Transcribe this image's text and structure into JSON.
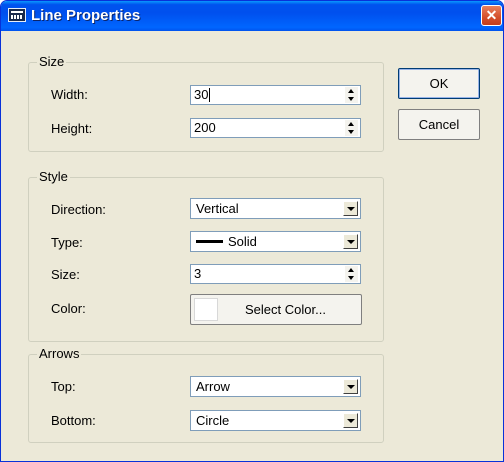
{
  "window": {
    "title": "Line Properties",
    "close_glyph": "✕"
  },
  "size_group": {
    "label": "Size",
    "width": {
      "label": "Width:",
      "value": "30"
    },
    "height": {
      "label": "Height:",
      "value": "200"
    }
  },
  "style_group": {
    "label": "Style",
    "direction": {
      "label": "Direction:",
      "value": "Vertical"
    },
    "type": {
      "label": "Type:",
      "value": "Solid"
    },
    "size": {
      "label": "Size:",
      "value": "3"
    },
    "color": {
      "label": "Color:",
      "button_label": "Select Color...",
      "swatch_color": "#ffffff"
    }
  },
  "arrows_group": {
    "label": "Arrows",
    "top": {
      "label": "Top:",
      "value": "Arrow"
    },
    "bottom": {
      "label": "Bottom:",
      "value": "Circle"
    }
  },
  "buttons": {
    "ok": "OK",
    "cancel": "Cancel"
  },
  "colors": {
    "title_bar": "#0053ee",
    "dialog_bg": "#ece9d8",
    "input_border": "#7f9db9",
    "close_button": "#d44f2c"
  },
  "icons": [
    "app-icon",
    "close-icon",
    "spin-up-icon",
    "spin-down-icon",
    "dropdown-arrow-icon"
  ]
}
